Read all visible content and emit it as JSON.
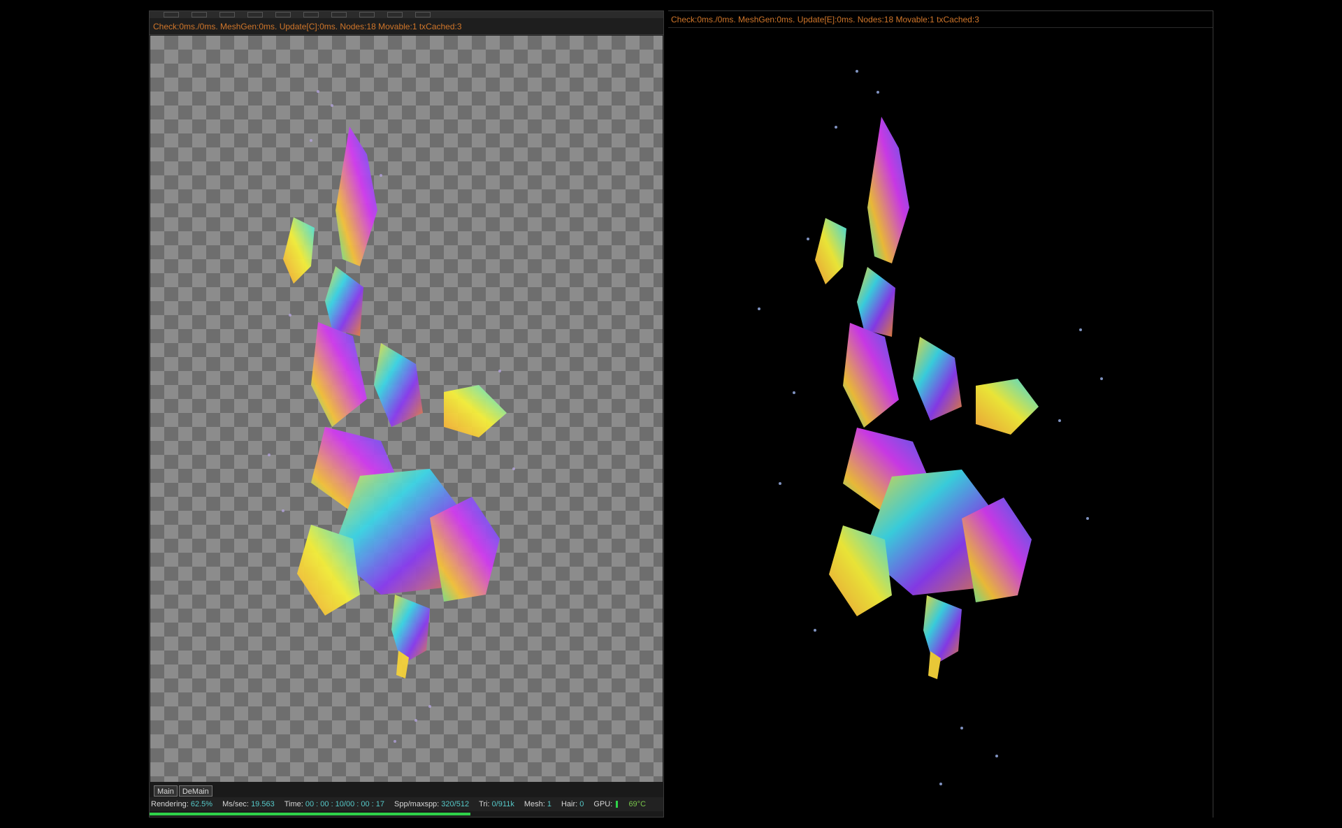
{
  "left_viewport": {
    "stats": "Check:0ms./0ms. MeshGen:0ms. Update[C]:0ms. Nodes:18 Movable:1 txCached:3",
    "tabs": [
      {
        "label": "Main"
      },
      {
        "label": "DeMain"
      }
    ],
    "status": {
      "rendering_label": "Rendering:",
      "rendering_value": "62.5%",
      "mssec_label": "Ms/sec:",
      "mssec_value": "19.563",
      "time_label": "Time:",
      "time_value": "00 : 00 : 10/00 : 00 : 17",
      "spp_label": "Spp/maxspp:",
      "spp_value": "320/512",
      "tri_label": "Tri:",
      "tri_value": "0/911k",
      "mesh_label": "Mesh:",
      "mesh_value": "1",
      "hair_label": "Hair:",
      "hair_value": "0",
      "gpu_label": "GPU:",
      "gpu_temp": "69°C"
    },
    "progress": 0.625
  },
  "right_viewport": {
    "stats": "Check:0ms./0ms. MeshGen:0ms. Update[E]:0ms. Nodes:18 Movable:1 txCached:3"
  },
  "colors": {
    "stats_text": "#d0762a",
    "value_cyan": "#56c9c9",
    "progress_green": "#2fd24a"
  }
}
